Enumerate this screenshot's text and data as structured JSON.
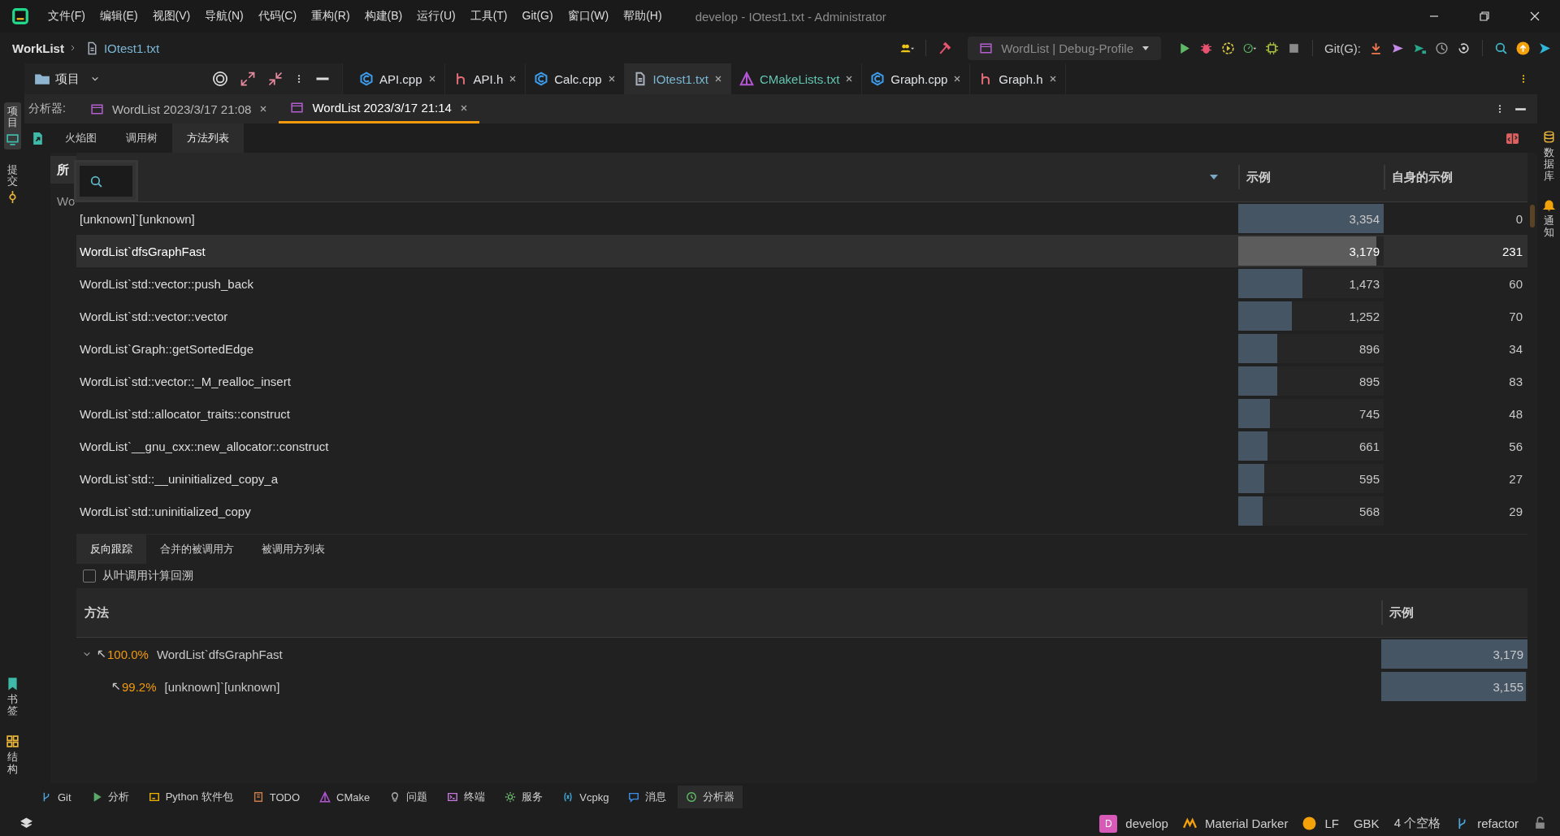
{
  "window": {
    "title": "develop - IOtest1.txt - Administrator"
  },
  "menu": [
    "文件(F)",
    "编辑(E)",
    "视图(V)",
    "导航(N)",
    "代码(C)",
    "重构(R)",
    "构建(B)",
    "运行(U)",
    "工具(T)",
    "Git(G)",
    "窗口(W)",
    "帮助(H)"
  ],
  "breadcrumb": {
    "project": "WorkList",
    "file": "IOtest1.txt"
  },
  "run_config": "WordList | Debug-Profile",
  "git_label": "Git(G):",
  "project_panel": {
    "title": "项目"
  },
  "editor_tabs": [
    {
      "label": "API.cpp",
      "kind": "cpp",
      "selected": false,
      "color": "#dfe1e5"
    },
    {
      "label": "API.h",
      "kind": "h",
      "selected": false,
      "color": "#dfe1e5"
    },
    {
      "label": "Calc.cpp",
      "kind": "cpp",
      "selected": false,
      "color": "#dfe1e5"
    },
    {
      "label": "IOtest1.txt",
      "kind": "txt",
      "selected": true,
      "color": "#7ab6d4"
    },
    {
      "label": "CMakeLists.txt",
      "kind": "cmake",
      "selected": false,
      "color": "#62c4b0"
    },
    {
      "label": "Graph.cpp",
      "kind": "cpp",
      "selected": false,
      "color": "#dfe1e5"
    },
    {
      "label": "Graph.h",
      "kind": "h",
      "selected": false,
      "color": "#dfe1e5"
    }
  ],
  "left_strip": [
    {
      "label": "项目",
      "kind": "project",
      "selected": true
    },
    {
      "label": "提交",
      "kind": "commit",
      "selected": false
    }
  ],
  "left_strip_bottom": [
    {
      "label": "书签",
      "kind": "bookmark"
    },
    {
      "label": "结构",
      "kind": "structure"
    }
  ],
  "right_strip": [
    {
      "label": "数据库",
      "kind": "database"
    },
    {
      "label": "通知",
      "kind": "bell"
    }
  ],
  "analyzer": {
    "label": "分析器:",
    "tabs": [
      {
        "label": "WordList 2023/3/17 21:08",
        "selected": false
      },
      {
        "label": "WordList 2023/3/17 21:14",
        "selected": true
      }
    ]
  },
  "view_tabs": [
    {
      "label": "火焰图",
      "selected": false
    },
    {
      "label": "调用树",
      "selected": false
    },
    {
      "label": "方法列表",
      "selected": true
    }
  ],
  "side_list": [
    {
      "label": "所",
      "selected": true
    },
    {
      "label": "Wo",
      "selected": false
    }
  ],
  "methods": {
    "columns": [
      "示例",
      "自身的示例"
    ],
    "rows": [
      {
        "name": "[unknown]`[unknown]",
        "samples": "3,354",
        "level": 1,
        "own": "0",
        "selected": false
      },
      {
        "name": "WordList`dfsGraphFast",
        "samples": "3,179",
        "level": 0.95,
        "own": "231",
        "selected": true
      },
      {
        "name": "WordList`std::vector::push_back",
        "samples": "1,473",
        "level": 0.44,
        "own": "60",
        "selected": false
      },
      {
        "name": "WordList`std::vector::vector",
        "samples": "1,252",
        "level": 0.37,
        "own": "70",
        "selected": false
      },
      {
        "name": "WordList`Graph::getSortedEdge",
        "samples": "896",
        "level": 0.27,
        "own": "34",
        "selected": false
      },
      {
        "name": "WordList`std::vector::_M_realloc_insert",
        "samples": "895",
        "level": 0.27,
        "own": "83",
        "selected": false
      },
      {
        "name": "WordList`std::allocator_traits::construct",
        "samples": "745",
        "level": 0.22,
        "own": "48",
        "selected": false
      },
      {
        "name": "WordList`__gnu_cxx::new_allocator::construct",
        "samples": "661",
        "level": 0.2,
        "own": "56",
        "selected": false
      },
      {
        "name": "WordList`std::__uninitialized_copy_a",
        "samples": "595",
        "level": 0.18,
        "own": "27",
        "selected": false
      },
      {
        "name": "WordList`std::uninitialized_copy",
        "samples": "568",
        "level": 0.17,
        "own": "29",
        "selected": false
      }
    ]
  },
  "backtrace": {
    "tabs": [
      {
        "label": "反向跟踪",
        "selected": true
      },
      {
        "label": "合并的被调用方",
        "selected": false
      },
      {
        "label": "被调用方列表",
        "selected": false
      }
    ],
    "checkbox": {
      "label": "从叶调用计算回溯",
      "checked": false
    },
    "columns": [
      "方法",
      "示例"
    ],
    "tree": [
      {
        "percent": "100.0%",
        "name": "WordList`dfsGraphFast",
        "samples": "3,179",
        "level": 1,
        "expanded": true,
        "children": [
          {
            "percent": "99.2%",
            "name": "[unknown]`[unknown]",
            "samples": "3,155",
            "level": 0.99
          }
        ]
      }
    ]
  },
  "tool_windows": [
    {
      "label": "Git",
      "kind": "branch",
      "selected": false
    },
    {
      "label": "分析",
      "kind": "play",
      "selected": false
    },
    {
      "label": "Python 软件包",
      "kind": "python",
      "selected": false
    },
    {
      "label": "TODO",
      "kind": "todo",
      "selected": false
    },
    {
      "label": "CMake",
      "kind": "cmake",
      "selected": false
    },
    {
      "label": "问题",
      "kind": "bulb",
      "selected": false
    },
    {
      "label": "终端",
      "kind": "terminal",
      "selected": false
    },
    {
      "label": "服务",
      "kind": "gear",
      "selected": false
    },
    {
      "label": "Vcpkg",
      "kind": "vcpkg",
      "selected": false
    },
    {
      "label": "消息",
      "kind": "chat",
      "selected": false
    },
    {
      "label": "分析器",
      "kind": "analyzer",
      "selected": true
    }
  ],
  "status_bar": {
    "branch_badge": "D",
    "branch": "develop",
    "theme": "Material Darker",
    "line_separator": "LF",
    "encoding": "GBK",
    "indent": "4 个空格",
    "vcs_branch": "refactor"
  }
}
